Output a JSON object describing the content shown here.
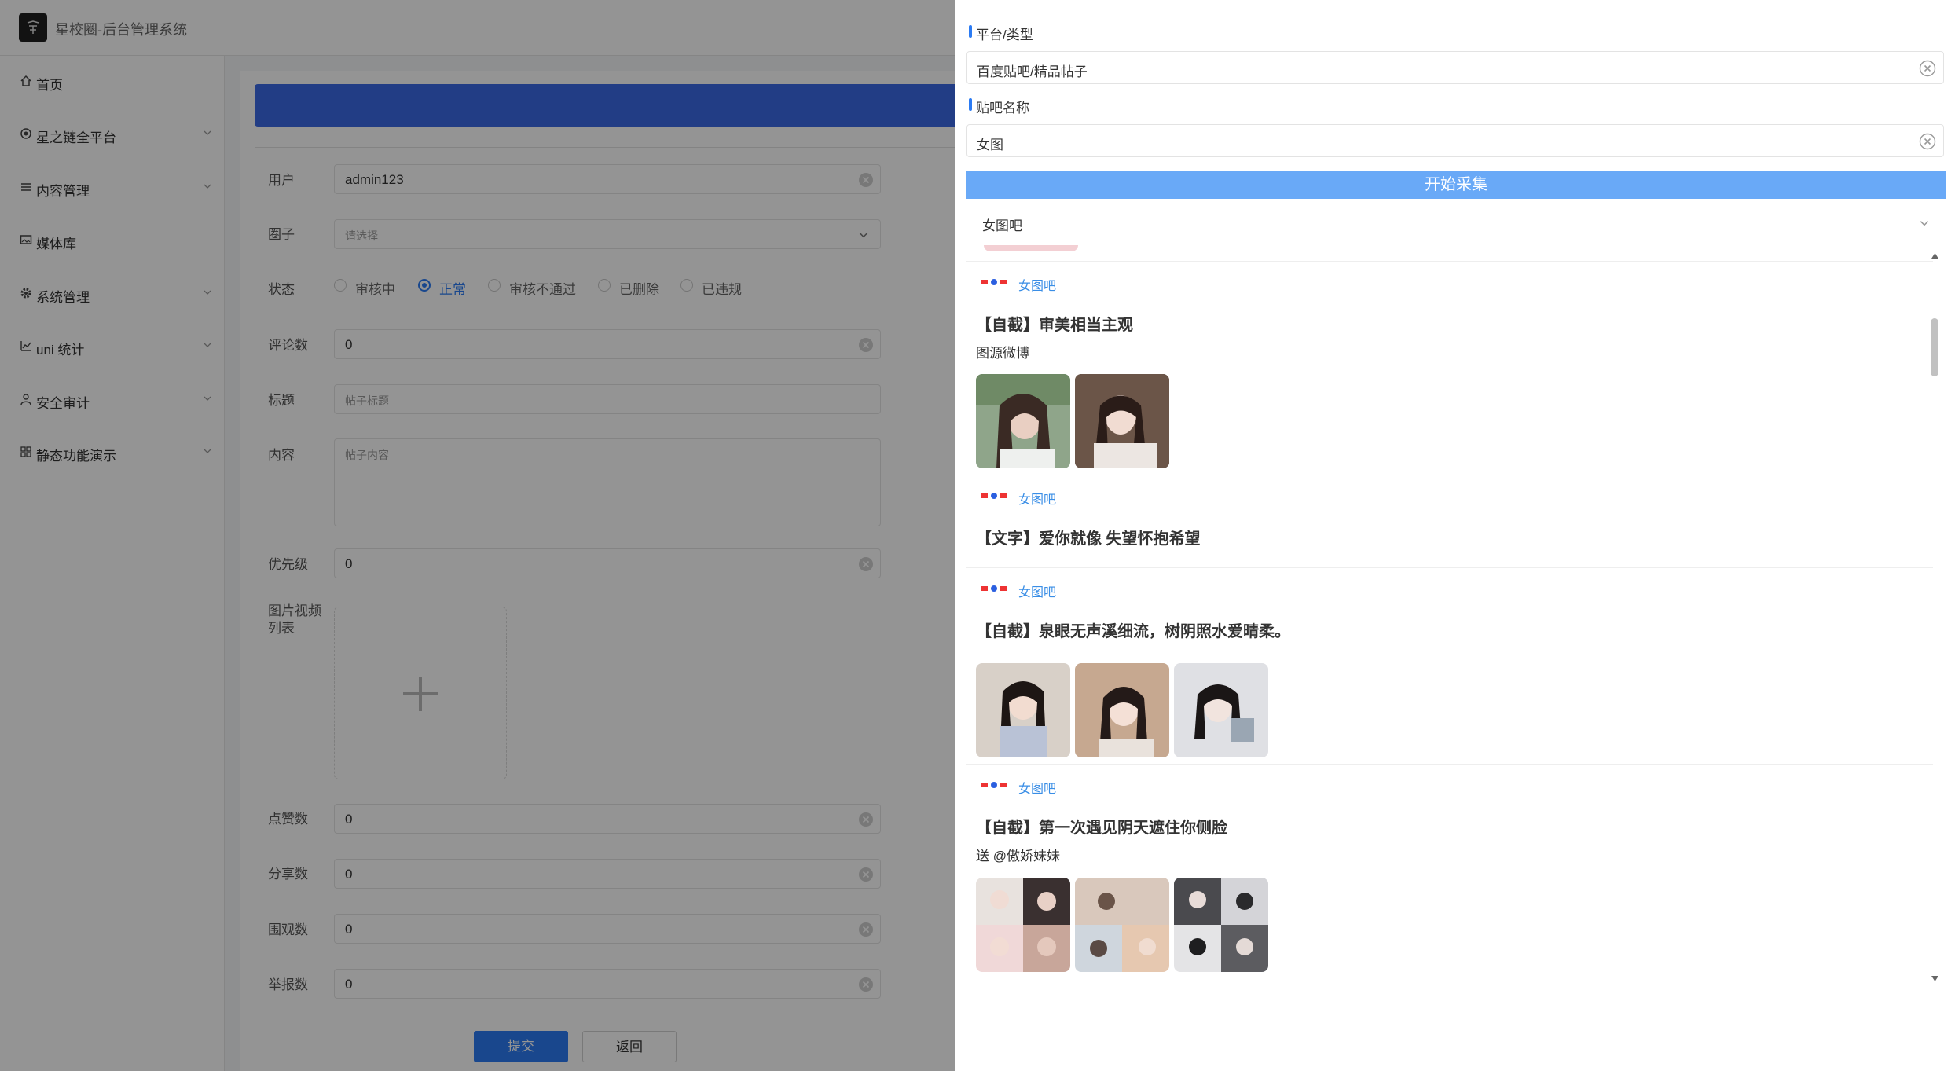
{
  "app": {
    "title": "星校圈-后台管理系统"
  },
  "sidebar": {
    "items": [
      {
        "label": "首页",
        "icon": "home-icon"
      },
      {
        "label": "星之链全平台",
        "icon": "platform-icon"
      },
      {
        "label": "内容管理",
        "icon": "list-icon"
      },
      {
        "label": "媒体库",
        "icon": "image-icon"
      },
      {
        "label": "系统管理",
        "icon": "gear-icon"
      },
      {
        "label": "uni 统计",
        "icon": "chart-icon"
      },
      {
        "label": "安全审计",
        "icon": "user-icon"
      },
      {
        "label": "静态功能演示",
        "icon": "grid-icon"
      }
    ]
  },
  "form": {
    "user": {
      "label": "用户",
      "value": "admin123"
    },
    "circle": {
      "label": "圈子",
      "placeholder": "请选择"
    },
    "status": {
      "label": "状态",
      "options": [
        "审核中",
        "正常",
        "审核不通过",
        "已删除",
        "已违规"
      ],
      "selected": "正常"
    },
    "comments": {
      "label": "评论数",
      "value": "0"
    },
    "title": {
      "label": "标题",
      "placeholder": "帖子标题"
    },
    "content": {
      "label": "内容",
      "placeholder": "帖子内容"
    },
    "priority": {
      "label": "优先级",
      "value": "0"
    },
    "media": {
      "label_line1": "图片视频",
      "label_line2": "列表"
    },
    "likes": {
      "label": "点赞数",
      "value": "0"
    },
    "shares": {
      "label": "分享数",
      "value": "0"
    },
    "views": {
      "label": "围观数",
      "value": "0"
    },
    "reports": {
      "label": "举报数",
      "value": "0"
    },
    "submit_label": "提交",
    "back_label": "返回"
  },
  "drawer": {
    "platform": {
      "label": "平台/类型",
      "value": "百度贴吧/精品帖子"
    },
    "bar_name": {
      "label": "贴吧名称",
      "value": "女图"
    },
    "collect_button": "开始采集",
    "selected_bar": "女图吧",
    "posts": [
      {
        "bar": "女图吧",
        "title": "【自截】审美相当主观",
        "desc": "图源微博",
        "images": 2
      },
      {
        "bar": "女图吧",
        "title": "【文字】爱你就像 失望怀抱希望",
        "desc": "",
        "images": 0
      },
      {
        "bar": "女图吧",
        "title": "【自截】泉眼无声溪细流，树阴照水爱晴柔。",
        "desc": "",
        "images": 3
      },
      {
        "bar": "女图吧",
        "title": "【自截】第一次遇见阴天遮住你侧脸",
        "desc": "送 @傲娇妹妹",
        "images": 3
      }
    ]
  },
  "colors": {
    "primary": "#2b7bf3",
    "banner": "#3b6ae6",
    "collect": "#69a9f7",
    "bar_link": "#3a8ee6"
  }
}
